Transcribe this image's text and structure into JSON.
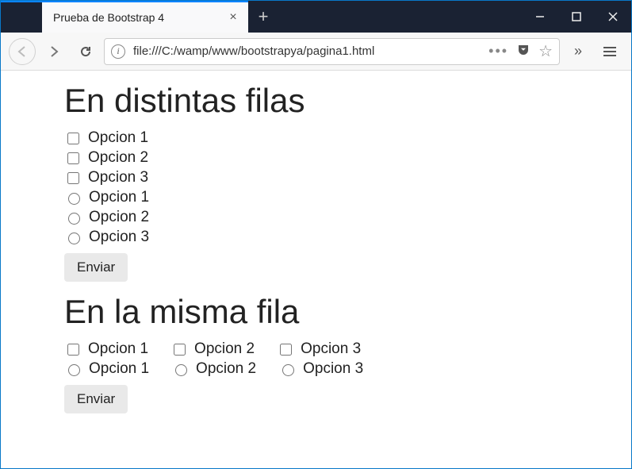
{
  "browser": {
    "tab_title": "Prueba de Bootstrap 4",
    "url": "file:///C:/wamp/www/bootstrapya/pagina1.html"
  },
  "page": {
    "heading1": "En distintas filas",
    "section1": {
      "checkboxes": [
        {
          "label": "Opcion 1"
        },
        {
          "label": "Opcion 2"
        },
        {
          "label": "Opcion 3"
        }
      ],
      "radios": [
        {
          "label": "Opcion 1"
        },
        {
          "label": "Opcion 2"
        },
        {
          "label": "Opcion 3"
        }
      ],
      "submit_label": "Enviar"
    },
    "heading2": "En la misma fila",
    "section2": {
      "checkboxes": [
        {
          "label": "Opcion 1"
        },
        {
          "label": "Opcion 2"
        },
        {
          "label": "Opcion 3"
        }
      ],
      "radios": [
        {
          "label": "Opcion 1"
        },
        {
          "label": "Opcion 2"
        },
        {
          "label": "Opcion 3"
        }
      ],
      "submit_label": "Enviar"
    }
  }
}
